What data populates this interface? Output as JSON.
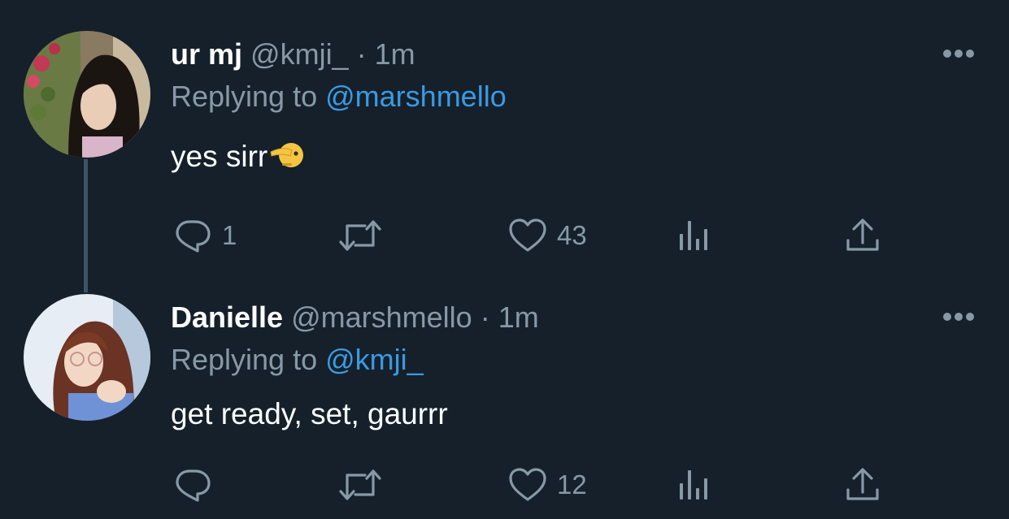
{
  "tweets": [
    {
      "name": "ur mj",
      "handle": "@kmji_",
      "separator": "·",
      "time": "1m",
      "replying_label": "Replying to",
      "replying_to": "@marshmello",
      "text": "yes sirr",
      "emoji_icon": "saluting-face-emoji",
      "reply_count": "1",
      "retweet_count": "",
      "like_count": "43"
    },
    {
      "name": "Danielle",
      "handle": "@marshmello",
      "separator": "·",
      "time": "1m",
      "replying_label": "Replying to",
      "replying_to": "@kmji_",
      "text": "get ready, set, gaurrr",
      "reply_count": "",
      "retweet_count": "",
      "like_count": "12"
    }
  ],
  "icons": {
    "reply": "reply-icon",
    "retweet": "retweet-icon",
    "like": "heart-icon",
    "analytics": "analytics-icon",
    "share": "share-icon",
    "more": "more-options-icon"
  },
  "colors": {
    "background": "#15202b",
    "text_primary": "#ffffff",
    "text_secondary": "#8899a6",
    "mention": "#3b9ae1",
    "thread_line": "#3d5466"
  }
}
